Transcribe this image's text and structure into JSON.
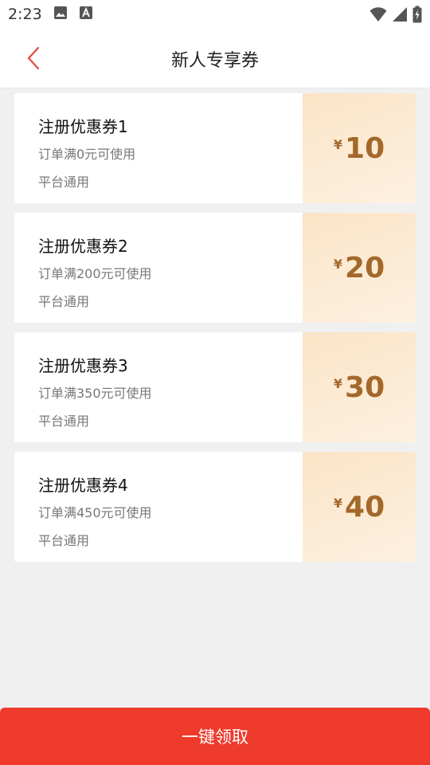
{
  "status_bar": {
    "time": "2:23"
  },
  "header": {
    "title": "新人专享券"
  },
  "coupons": [
    {
      "name": "注册优惠券1",
      "condition": "订单满0元可使用",
      "scope": "平台通用",
      "currency": "¥",
      "amount": "10"
    },
    {
      "name": "注册优惠券2",
      "condition": "订单满200元可使用",
      "scope": "平台通用",
      "currency": "¥",
      "amount": "20"
    },
    {
      "name": "注册优惠券3",
      "condition": "订单满350元可使用",
      "scope": "平台通用",
      "currency": "¥",
      "amount": "30"
    },
    {
      "name": "注册优惠券4",
      "condition": "订单满450元可使用",
      "scope": "平台通用",
      "currency": "¥",
      "amount": "40"
    }
  ],
  "footer": {
    "claim_all_label": "一键领取"
  },
  "colors": {
    "accent": "#ee3b2c",
    "back_arrow": "#e8483b",
    "coupon_amount": "#a3682a"
  },
  "icons": {
    "status_left": [
      "image-icon",
      "a-download-icon"
    ],
    "status_right": [
      "wifi-icon",
      "signal-icon",
      "battery-icon"
    ],
    "back": "chevron-left-icon"
  }
}
